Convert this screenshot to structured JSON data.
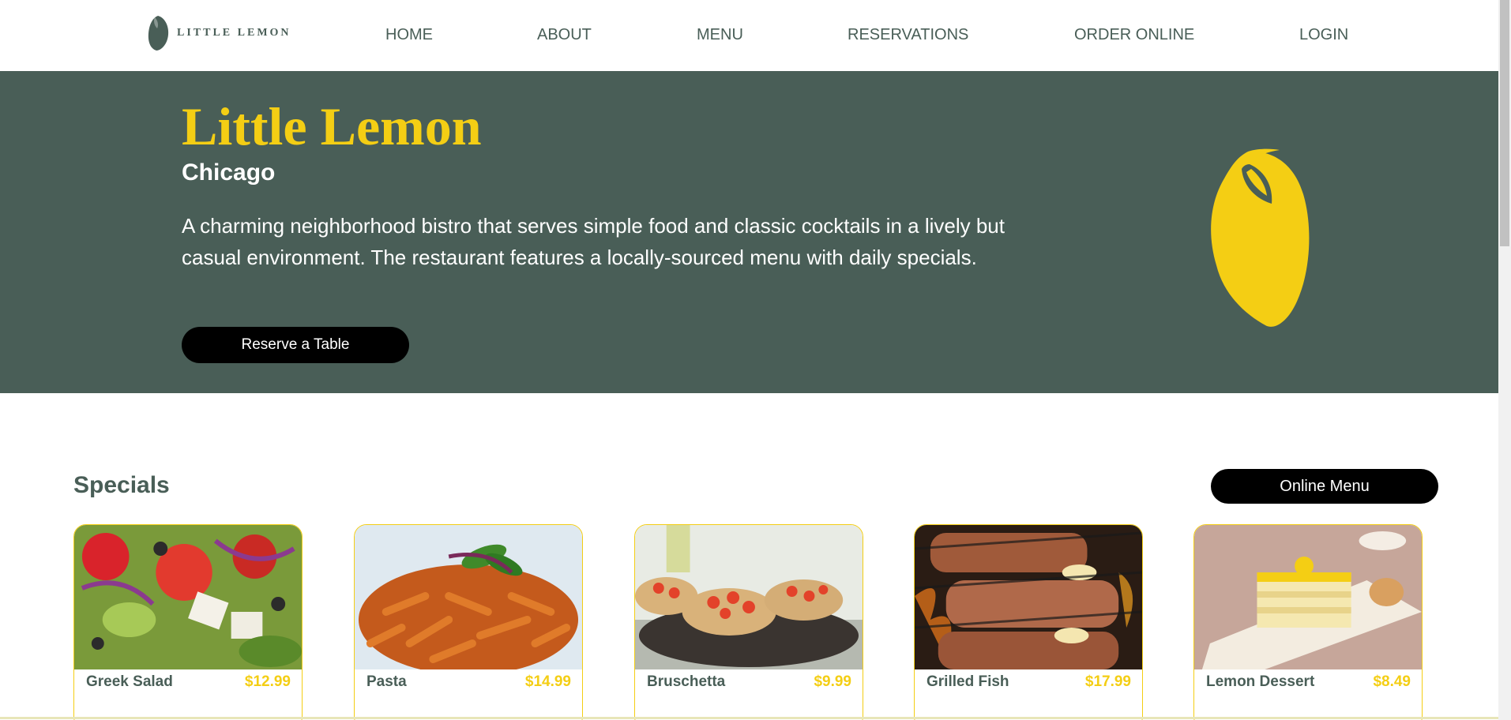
{
  "header": {
    "logo_text": "LITTLE LEMON",
    "nav": [
      "HOME",
      "ABOUT",
      "MENU",
      "RESERVATIONS",
      "ORDER ONLINE",
      "LOGIN"
    ]
  },
  "hero": {
    "title": "Little Lemon",
    "city": "Chicago",
    "description": "A charming neighborhood bistro that serves simple food and classic cocktails in a lively but casual environment. The restaurant features a locally-sourced menu with daily specials.",
    "reserve_label": "Reserve a Table"
  },
  "specials": {
    "title": "Specials",
    "online_menu_label": "Online Menu",
    "items": [
      {
        "name": "Greek Salad",
        "price": "$12.99"
      },
      {
        "name": "Pasta",
        "price": "$14.99"
      },
      {
        "name": "Bruschetta",
        "price": "$9.99"
      },
      {
        "name": "Grilled Fish",
        "price": "$17.99"
      },
      {
        "name": "Lemon Dessert",
        "price": "$8.49"
      }
    ]
  },
  "colors": {
    "primary_green": "#495e57",
    "primary_yellow": "#f4ce14",
    "button_black": "#000000"
  }
}
